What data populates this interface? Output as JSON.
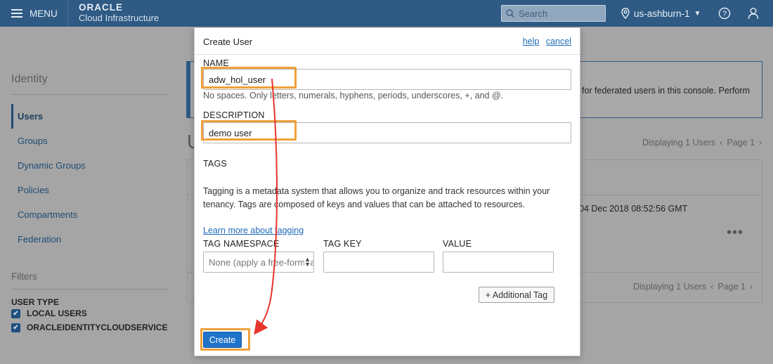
{
  "topbar": {
    "menu_label": "MENU",
    "logo_line1": "ORACLE",
    "logo_line2": "Cloud Infrastructure",
    "search_placeholder": "Search",
    "region": "us-ashburn-1"
  },
  "sidebar": {
    "title": "Identity",
    "items": [
      {
        "label": "Users",
        "active": true
      },
      {
        "label": "Groups"
      },
      {
        "label": "Dynamic Groups"
      },
      {
        "label": "Policies"
      },
      {
        "label": "Compartments"
      },
      {
        "label": "Federation"
      }
    ],
    "filters_title": "Filters",
    "user_type_label": "USER TYPE",
    "checkboxes": [
      {
        "label": "LOCAL USERS",
        "checked": true
      },
      {
        "label": "ORACLEIDENTITYCLOUDSERVICE",
        "checked": true
      }
    ]
  },
  "background": {
    "info_text": "for federated users in this console. Perform",
    "heading": "U",
    "displaying_top": "Displaying 1 Users",
    "page_top": "Page 1",
    "created_text": "04 Dec 2018 08:52:56 GMT",
    "more_dots": "•••",
    "displaying_bottom": "Displaying 1 Users",
    "page_bottom": "Page 1"
  },
  "modal": {
    "title": "Create User",
    "help_link": "help",
    "cancel_link": "cancel",
    "name_label": "NAME",
    "name_value": "adw_hol_user",
    "name_hint": "No spaces. Only letters, numerals, hyphens, periods, underscores, +, and @.",
    "description_label": "DESCRIPTION",
    "description_value": "demo user",
    "tags_label": "TAGS",
    "tags_paragraph": "Tagging is a metadata system that allows you to organize and track resources within your tenancy. Tags are composed of keys and values that can be attached to resources.",
    "learn_more_link": "Learn more about tagging",
    "tag_namespace_label": "TAG NAMESPACE",
    "tag_key_label": "TAG KEY",
    "value_label": "VALUE",
    "tag_namespace_placeholder": "None (apply a free-form tag)",
    "additional_tag_button": "+ Additional Tag",
    "create_button": "Create"
  },
  "colors": {
    "topbar": "#2e5a84",
    "primary_button": "#1f73c9",
    "highlight": "#f0a03b",
    "annotation_arrow": "#e8332a",
    "link": "#1f6bb5"
  }
}
